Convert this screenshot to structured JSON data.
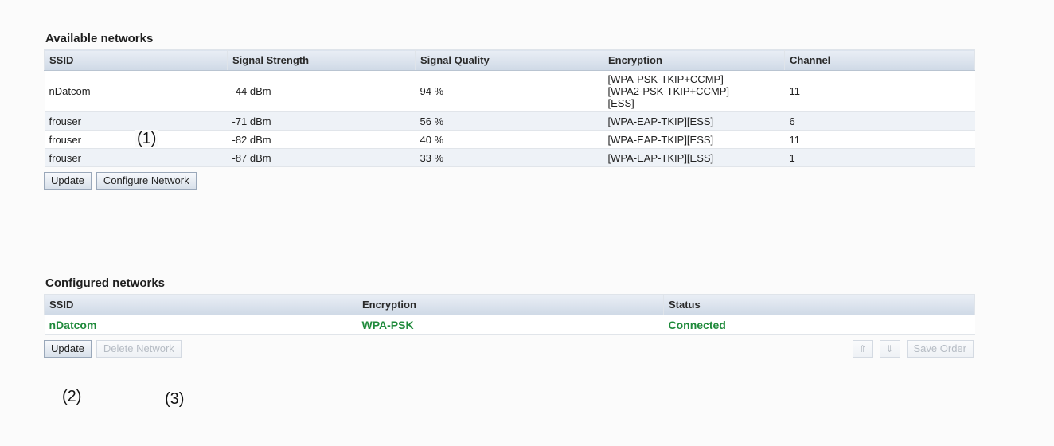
{
  "available": {
    "title": "Available networks",
    "headers": [
      "SSID",
      "Signal Strength",
      "Signal Quality",
      "Encryption",
      "Channel"
    ],
    "rows": [
      {
        "ssid": "nDatcom",
        "strength": "-44 dBm",
        "quality": "94 %",
        "encryption": "[WPA-PSK-TKIP+CCMP]\n[WPA2-PSK-TKIP+CCMP]\n[ESS]",
        "channel": "11"
      },
      {
        "ssid": "frouser",
        "strength": "-71 dBm",
        "quality": "56 %",
        "encryption": "[WPA-EAP-TKIP][ESS]",
        "channel": "6"
      },
      {
        "ssid": "frouser",
        "strength": "-82 dBm",
        "quality": "40 %",
        "encryption": "[WPA-EAP-TKIP][ESS]",
        "channel": "11"
      },
      {
        "ssid": "frouser",
        "strength": "-87 dBm",
        "quality": "33 %",
        "encryption": "[WPA-EAP-TKIP][ESS]",
        "channel": "1"
      }
    ],
    "update_label": "Update",
    "configure_label": "Configure Network"
  },
  "configured": {
    "title": "Configured networks",
    "headers": [
      "SSID",
      "Encryption",
      "Status"
    ],
    "rows": [
      {
        "ssid": "nDatcom",
        "encryption": "WPA-PSK",
        "status": "Connected"
      }
    ],
    "update_label": "Update",
    "delete_label": "Delete Network",
    "up_label": "⇑",
    "down_label": "⇓",
    "save_order_label": "Save Order"
  },
  "annotations": {
    "a1": "(1)",
    "a2": "(2)",
    "a3": "(3)"
  },
  "colors": {
    "connected_green": "#1f8a3b",
    "header_blue": "#cfd9e6"
  }
}
